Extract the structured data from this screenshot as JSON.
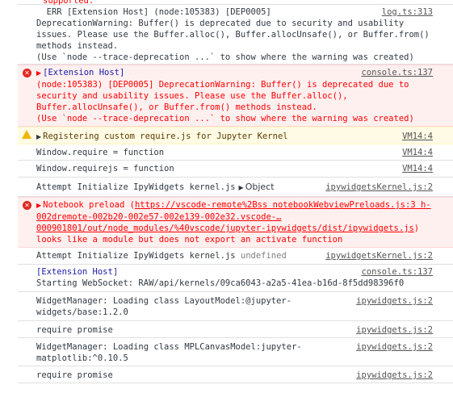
{
  "messages": {
    "m0": {
      "text": "supported."
    },
    "m1": {
      "prefix": "  ERR [Extension Host] (node:105383) [DEP0005]",
      "rest": "DeprecationWarning: Buffer() is deprecated due to security and usability issues. Please use the Buffer.alloc(), Buffer.allocUnsafe(), or Buffer.from() methods instead.\n(Use `node --trace-deprecation ...` to show where the warning was created)",
      "source": "log.ts:313"
    },
    "m2": {
      "header": "[Extension Host]",
      "body": "(node:105383) [DEP0005] DeprecationWarning: Buffer() is deprecated due to security and usability issues. Please use the Buffer.alloc(), Buffer.allocUnsafe(), or Buffer.from() methods instead.\n(Use `node --trace-deprecation ...` to show where the warning was created)",
      "source": "console.ts:137"
    },
    "m3": {
      "text": "Registering custom require.js for Jupyter Kernel",
      "source": "VM14:4"
    },
    "m4": {
      "text": "Window.require = function",
      "source": "VM14:4"
    },
    "m5": {
      "text": "Window.requirejs = function",
      "source": "VM14:4"
    },
    "m6": {
      "text": "Attempt Initialize IpyWidgets kernel.js",
      "object": "Object",
      "source": "ipywidgetsKernel.js:2"
    },
    "m7": {
      "prefix": "Notebook preload (",
      "url": "https://vscode-remote%2Bss notebookWebviewPreloads.js:3 h-002dremote-002b20-002e57-002e139-002e32.vscode-…000901801/out/node_modules/%40vscode/jupyter-ipywidgets/dist/ipywidgets.js",
      "suffix": ") looks like a module but does not export an activate function"
    },
    "m8": {
      "text": "Attempt Initialize IpyWidgets kernel.js",
      "value": "undefined",
      "source": "ipywidgetsKernel.js:2"
    },
    "m9": {
      "header": "[Extension Host]",
      "text": "Starting WebSocket: RAW/api/kernels/09ca6043-a2a5-41ea-b16d-8f5dd98396f0",
      "source": "console.ts:137"
    },
    "m10": {
      "text": "WidgetManager: Loading class LayoutModel:@jupyter-widgets/base:1.2.0",
      "source": "ipywidgets.js:2"
    },
    "m11": {
      "text": "require promise",
      "source": "ipywidgets.js:2"
    },
    "m12": {
      "text": "WidgetManager: Loading class MPLCanvasModel:jupyter-matplotlib:^0.10.5",
      "source": "ipywidgets.js:2"
    },
    "m13": {
      "text": "require promise",
      "source": "ipywidgets.js:2"
    }
  },
  "colors": {
    "error_bg": "#fff0f0",
    "error_text": "#ff0000",
    "warn_bg": "#fffbe5",
    "header_blue": "#1a1aa6"
  },
  "icons": {
    "error": "error-circle-icon",
    "warn": "warning-triangle-icon",
    "expand": "triangle-right-icon"
  }
}
